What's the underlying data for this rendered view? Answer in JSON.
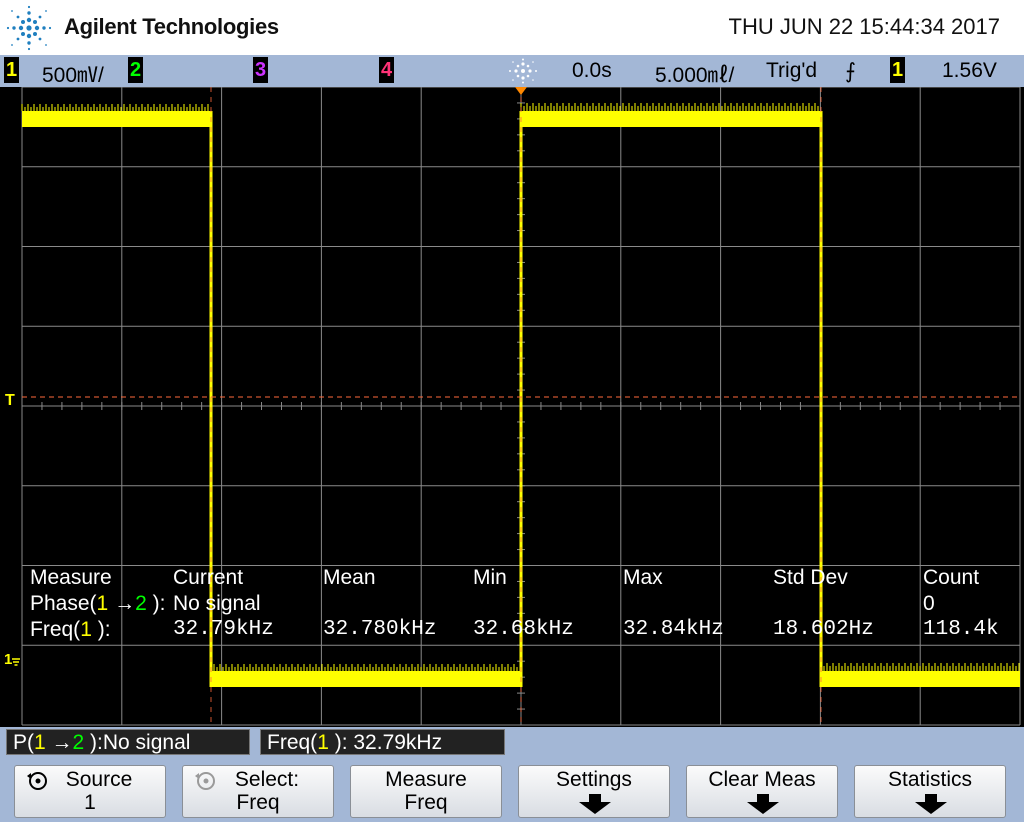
{
  "header": {
    "brand": "Agilent Technologies",
    "datetime": "THU JUN 22 15:44:34 2017"
  },
  "status": {
    "ch1_num": "1",
    "ch1_scale": "500㎷/",
    "ch2_num": "2",
    "ch3_num": "3",
    "ch4_num": "4",
    "time_delay": "0.0s",
    "time_scale": "5.000㎖/",
    "trigger_state": "Trig'd",
    "trigger_slope": "⨍",
    "trigger_channel": "1",
    "trigger_level": "1.56V"
  },
  "colors": {
    "ch1": "#ffff00",
    "ch2": "#00ff00",
    "ch3": "#cc33ff",
    "ch4": "#ff3377",
    "grid": "#8a8a8a",
    "trigger_line": "#ff6a3c",
    "panel": "#a3b7d6"
  },
  "markers": {
    "trigger": "T",
    "ground_ch1": "1"
  },
  "waveform": {
    "frequency_khz": 32.79,
    "high_level": "top",
    "low_level": "bottom"
  },
  "measurements": {
    "headers": [
      "Measure",
      "Current",
      "Mean",
      "Min",
      "Max",
      "Std Dev",
      "Count"
    ],
    "rows": [
      {
        "label_pre": "Phase(",
        "src_a": "1",
        "arrow": " →",
        "src_b": "2",
        "label_post": " ):",
        "values": [
          "No signal",
          "",
          "",
          "",
          "",
          "0"
        ]
      },
      {
        "label_pre": "Freq(",
        "src_a": "1",
        "label_post": " ):",
        "values": [
          "32.79kHz",
          "32.780kHz",
          "32.68kHz",
          "32.84kHz",
          "18.602Hz",
          "118.4k"
        ]
      }
    ]
  },
  "readouts": {
    "phase": {
      "pre": "P(",
      "a": "1",
      "arrow": " →",
      "b": "2",
      "post": " ):No signal"
    },
    "freq": {
      "pre": "Freq(",
      "a": "1",
      "post": " ): 32.79kHz"
    }
  },
  "softkeys": [
    {
      "line1": "Source",
      "line2": "1",
      "icon": "rotate-knob-icon"
    },
    {
      "line1": "Select:",
      "line2": "Freq",
      "icon": "rotate-knob-icon"
    },
    {
      "line1": "Measure",
      "line2": "Freq"
    },
    {
      "line1": "Settings",
      "icon": "arrow-down-icon"
    },
    {
      "line1": "Clear Meas",
      "icon": "arrow-down-icon"
    },
    {
      "line1": "Statistics",
      "icon": "arrow-down-icon"
    }
  ]
}
